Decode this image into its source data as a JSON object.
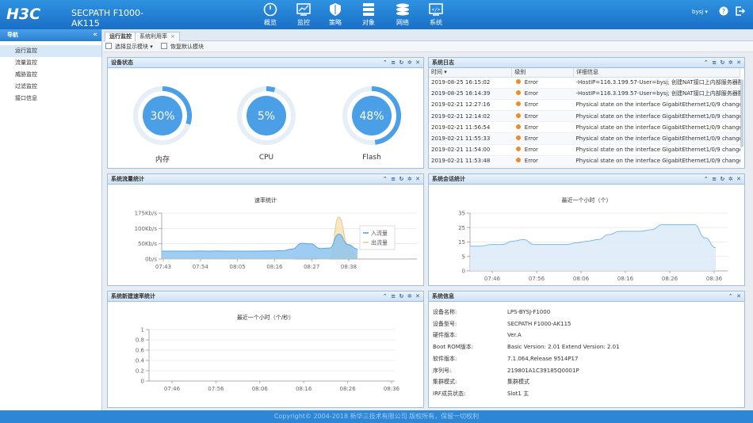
{
  "header": {
    "logo": "H3C",
    "product": "SECPATH F1000-AK115",
    "nav": [
      {
        "label": "概览",
        "icon": "overview-icon"
      },
      {
        "label": "监控",
        "icon": "monitor-icon"
      },
      {
        "label": "策略",
        "icon": "shield-icon"
      },
      {
        "label": "对象",
        "icon": "object-icon"
      },
      {
        "label": "网络",
        "icon": "network-icon"
      },
      {
        "label": "系统",
        "icon": "system-icon"
      }
    ],
    "user": "bysj ▾"
  },
  "sidebar": {
    "title": "导航",
    "items": [
      {
        "label": "运行监控",
        "active": true
      },
      {
        "label": "流量监控"
      },
      {
        "label": "威胁监控"
      },
      {
        "label": "过滤监控"
      },
      {
        "label": "接口信息"
      }
    ]
  },
  "tabs": [
    {
      "label": "运行监控"
    },
    {
      "label": "系统利用率"
    }
  ],
  "toolbar": {
    "choose": "选择显示模块",
    "restore": "恢复默认模块"
  },
  "device_status": {
    "title": "设备状态",
    "gauges": [
      {
        "label": "内存",
        "value": "30%",
        "pct": 30
      },
      {
        "label": "CPU",
        "value": "5%",
        "pct": 5
      },
      {
        "label": "Flash",
        "value": "48%",
        "pct": 48
      }
    ]
  },
  "syslog": {
    "title": "系统日志",
    "columns": [
      "时间",
      "级别",
      "详细信息"
    ],
    "rows": [
      {
        "time": "2019-08-25 16:15:02",
        "level": "Error",
        "detail": "-HostIP=116.3.199.57-User=bysj; 创建NAT接口上内部服务器配..."
      },
      {
        "time": "2019-08-25 16:14:39",
        "level": "Error",
        "detail": "-HostIP=116.3.199.57-User=bysj; 创建NAT接口上内部服务器配..."
      },
      {
        "time": "2019-02-21 12:27:16",
        "level": "Error",
        "detail": "Physical state on the interface GigabitEthernet1/0/9 changed to up."
      },
      {
        "time": "2019-02-21 12:14:02",
        "level": "Error",
        "detail": "Physical state on the interface GigabitEthernet1/0/9 changed to d..."
      },
      {
        "time": "2019-02-21 11:56:54",
        "level": "Error",
        "detail": "Physical state on the interface GigabitEthernet1/0/9 changed to up."
      },
      {
        "time": "2019-02-21 11:55:33",
        "level": "Error",
        "detail": "Physical state on the interface GigabitEthernet1/0/9 changed to d..."
      },
      {
        "time": "2019-02-21 11:54:00",
        "level": "Error",
        "detail": "Physical state on the interface GigabitEthernet1/0/9 changed to up."
      },
      {
        "time": "2019-02-21 11:53:48",
        "level": "Error",
        "detail": "Physical state on the interface GigabitEthernet1/0/9 changed to d..."
      }
    ]
  },
  "colors": {
    "accent": "#4a9fe6",
    "error_dot": "#f08a24",
    "inflow": "#8ec4ef",
    "outflow": "#f7e3b5"
  },
  "chart_data": [
    {
      "type": "area",
      "panel": "系统流量统计",
      "title": "速率统计",
      "x": [
        "07:43",
        "07:54",
        "08:05",
        "08:16",
        "08:27",
        "08:38"
      ],
      "yticks": [
        "175Kb/s",
        "100Kb/s",
        "50Kb/s",
        "0b/s"
      ],
      "ylim": [
        0,
        175
      ],
      "series": [
        {
          "name": "入流量",
          "values": [
            30,
            30,
            30,
            30,
            31,
            30,
            31,
            30,
            30,
            30,
            30,
            31,
            31,
            32,
            38,
            60,
            58,
            40,
            42,
            95,
            55,
            38
          ]
        },
        {
          "name": "出流量",
          "values": [
            0,
            0,
            0,
            0,
            0,
            0,
            0,
            0,
            0,
            0,
            0,
            0,
            0,
            0,
            0,
            4,
            3,
            0,
            0,
            160,
            55,
            0
          ]
        }
      ]
    },
    {
      "type": "area",
      "panel": "系统会话统计",
      "title": "最近一个小时（个）",
      "x": [
        "07:46",
        "07:56",
        "08:06",
        "08:16",
        "08:26",
        "08:36"
      ],
      "yticks": [
        "35",
        "25",
        "15",
        "5",
        "0"
      ],
      "ylim": [
        0,
        35
      ],
      "series": [
        {
          "values": [
            15,
            15,
            16,
            16,
            18,
            19,
            16,
            16,
            16,
            16,
            17,
            18,
            19,
            22,
            24,
            24,
            24,
            25,
            28,
            28,
            28,
            28,
            20,
            14
          ]
        }
      ]
    },
    {
      "type": "line",
      "panel": "系统新建速率统计",
      "title": "最近一个小时（个/秒）",
      "x": [
        "07:46",
        "07:56",
        "08:06",
        "08:16",
        "08:26",
        "08:36"
      ],
      "yticks": [
        "1",
        "0.8",
        "0.6",
        "0.4",
        "0.2",
        "0"
      ],
      "ylim": [
        0,
        1
      ],
      "series": [
        {
          "values": []
        }
      ]
    }
  ],
  "sysinfo": {
    "title": "系统信息",
    "rows": [
      {
        "k": "设备名称:",
        "v": "LPS-BYSJ-F1000"
      },
      {
        "k": "设备型号:",
        "v": "SECPATH F1000-AK115"
      },
      {
        "k": "硬件版本:",
        "v": "Ver.A"
      },
      {
        "k": "Boot ROM版本:",
        "v": "Basic Version: 2.01 Extend Version: 2.01"
      },
      {
        "k": "软件版本:",
        "v": "7.1.064,Release 9514P17"
      },
      {
        "k": "序列号:",
        "v": "219801A1C39185Q0001P"
      },
      {
        "k": "集群模式:",
        "v": "集群模式"
      },
      {
        "k": "IRF成员状态:",
        "v": "Slot1 主"
      }
    ]
  },
  "panels": {
    "traffic": "系统流量统计",
    "session": "系统会话统计",
    "newrate": "系统新建速率统计"
  },
  "footer": "Copyright© 2004-2018 新华三技术有限公司 版权所有，保留一切权利"
}
